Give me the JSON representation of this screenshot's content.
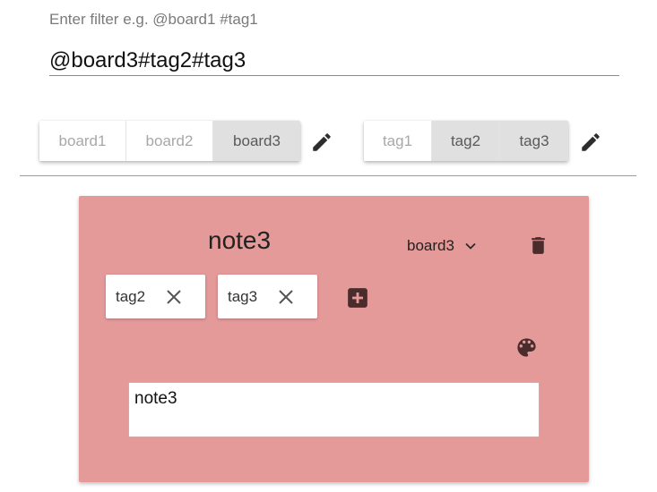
{
  "filter": {
    "label": "Enter filter e.g. @board1 #tag1",
    "value": "@board3#tag2#tag3"
  },
  "boards": {
    "items": [
      "board1",
      "board2",
      "board3"
    ],
    "selected": "board3",
    "edit_icon": "pencil-icon"
  },
  "tags": {
    "items": [
      "tag1",
      "tag2",
      "tag3"
    ],
    "selected": [
      "tag2",
      "tag3"
    ],
    "edit_icon": "pencil-icon"
  },
  "note": {
    "title": "note3",
    "board": "board3",
    "background_color": "#e59a9a",
    "icon_color": "#4a2c2c",
    "tags": [
      "tag2",
      "tag3"
    ],
    "content": "note3",
    "icons": {
      "board_dropdown": "chevron-down-icon",
      "delete": "trash-icon",
      "remove_tag": "close-icon",
      "add_tag": "plus-box-icon",
      "color": "palette-icon"
    }
  }
}
